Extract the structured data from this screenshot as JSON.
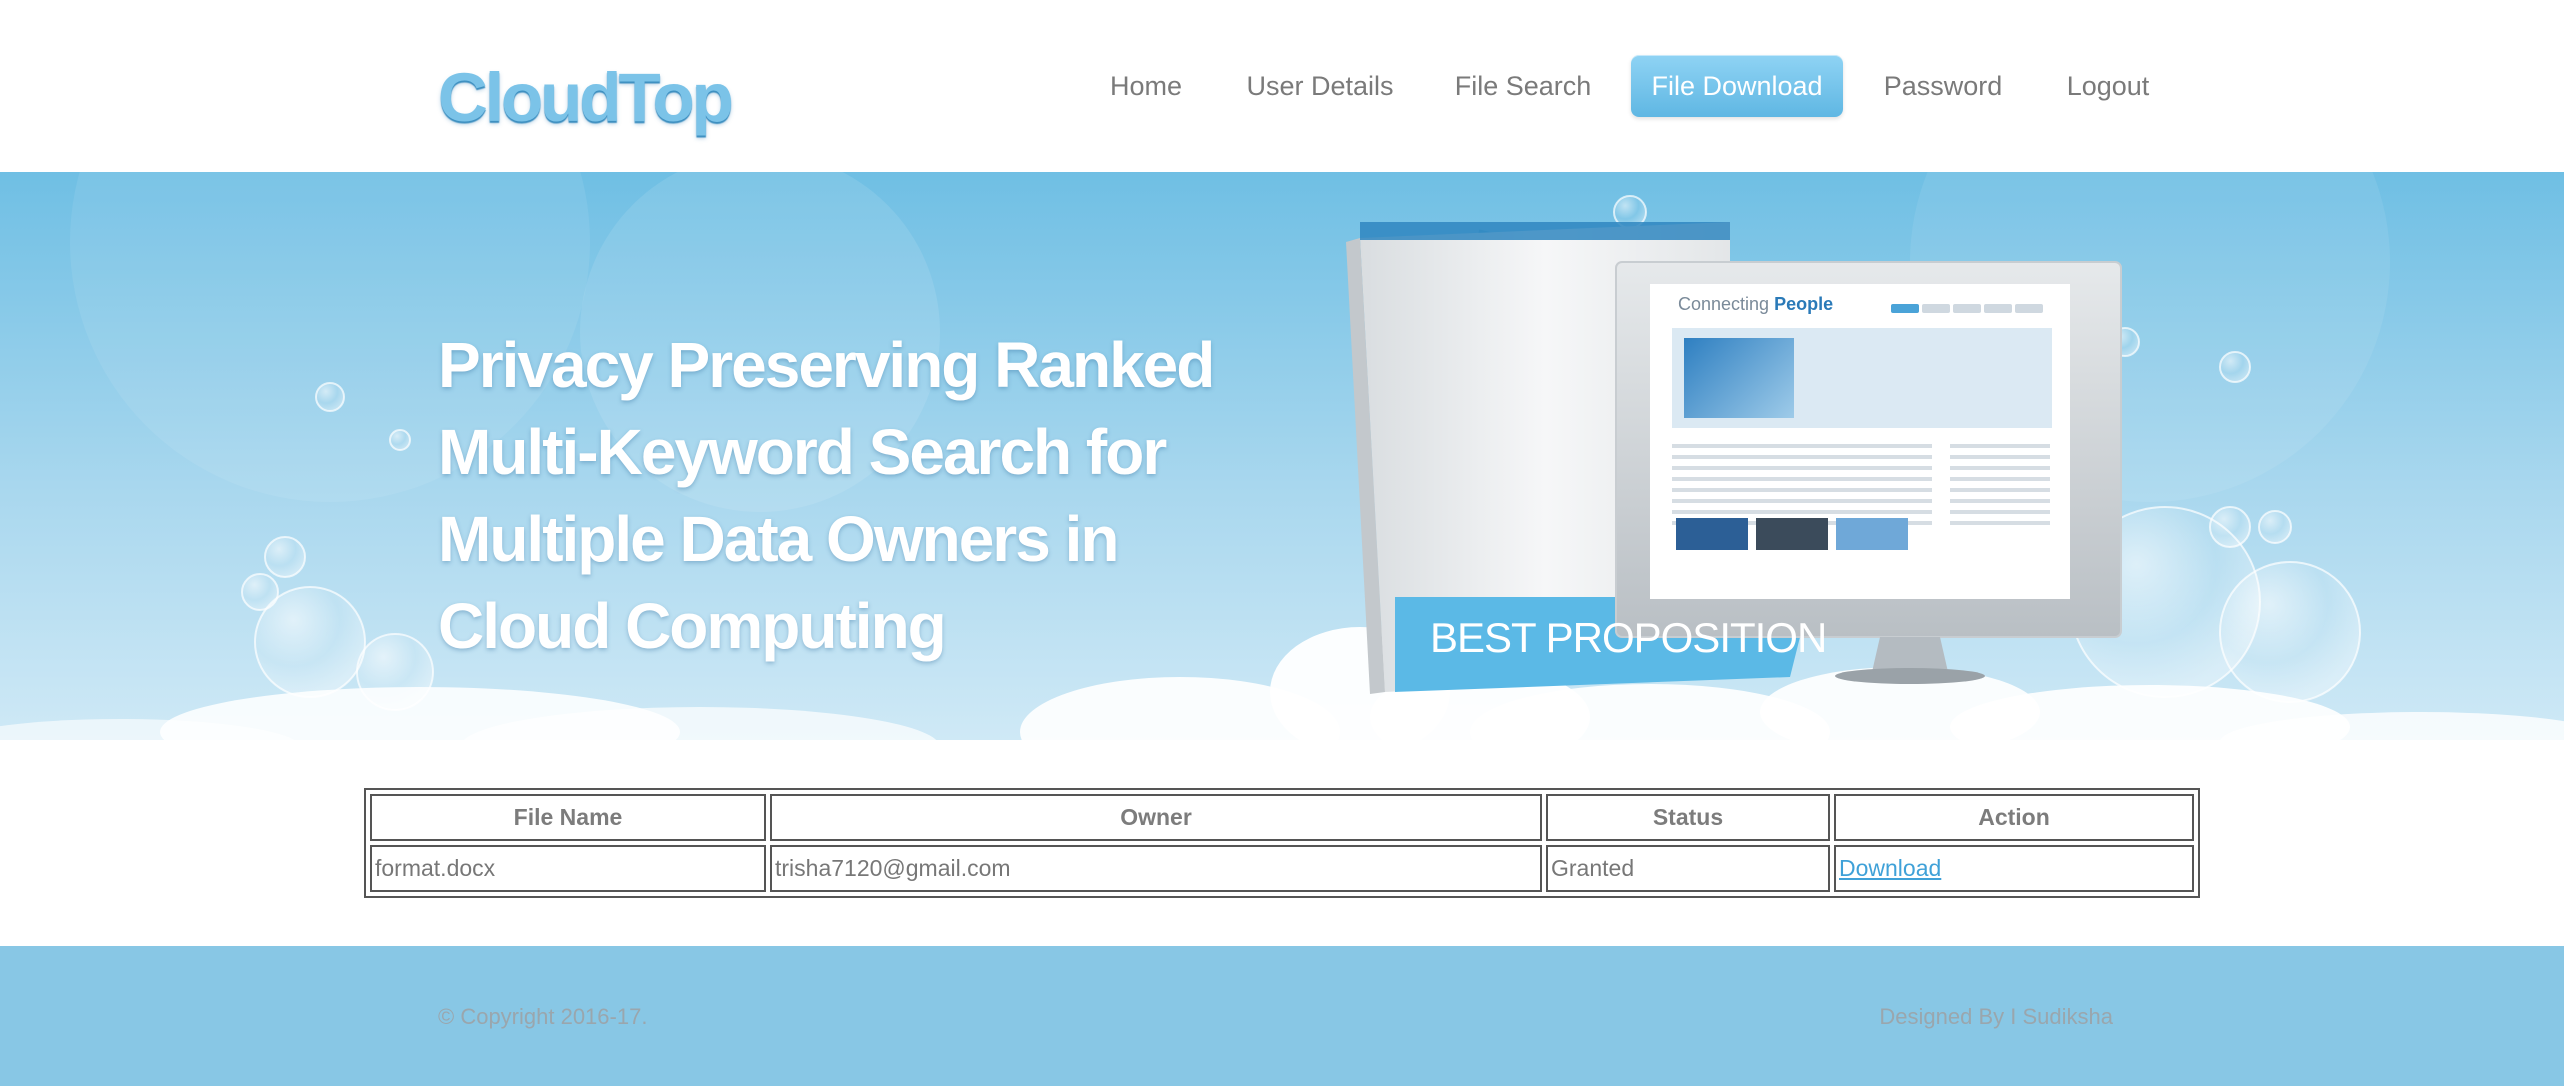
{
  "brand": {
    "logo": "CloudTop"
  },
  "nav": {
    "items": [
      {
        "label": "Home"
      },
      {
        "label": "User Details"
      },
      {
        "label": "File Search"
      },
      {
        "label": "File Download",
        "active": true
      },
      {
        "label": "Password"
      },
      {
        "label": "Logout"
      }
    ]
  },
  "banner": {
    "headline_lines": [
      "Privacy Preserving Ranked",
      "Multi-Keyword Search for",
      "Multiple Data Owners in",
      "Cloud Computing"
    ],
    "badge": "BEST PROPOSITION",
    "screen_title_prefix": "Connecting",
    "screen_title_highlight": "People"
  },
  "table": {
    "headers": [
      "File Name",
      "Owner",
      "Status",
      "Action"
    ],
    "rows": [
      {
        "file_name": "format.docx",
        "owner": "trisha7120@gmail.com",
        "status": "Granted",
        "action": "Download"
      }
    ]
  },
  "footer": {
    "copyright": "© Copyright 2016-17.",
    "designed_by": "Designed By I Sudiksha"
  },
  "colors": {
    "accent": "#7bc3e8",
    "nav_active": "#6cbfe8",
    "banner": "#7cc4e6",
    "footer": "#88c7e5",
    "link": "#3fa1d8"
  }
}
